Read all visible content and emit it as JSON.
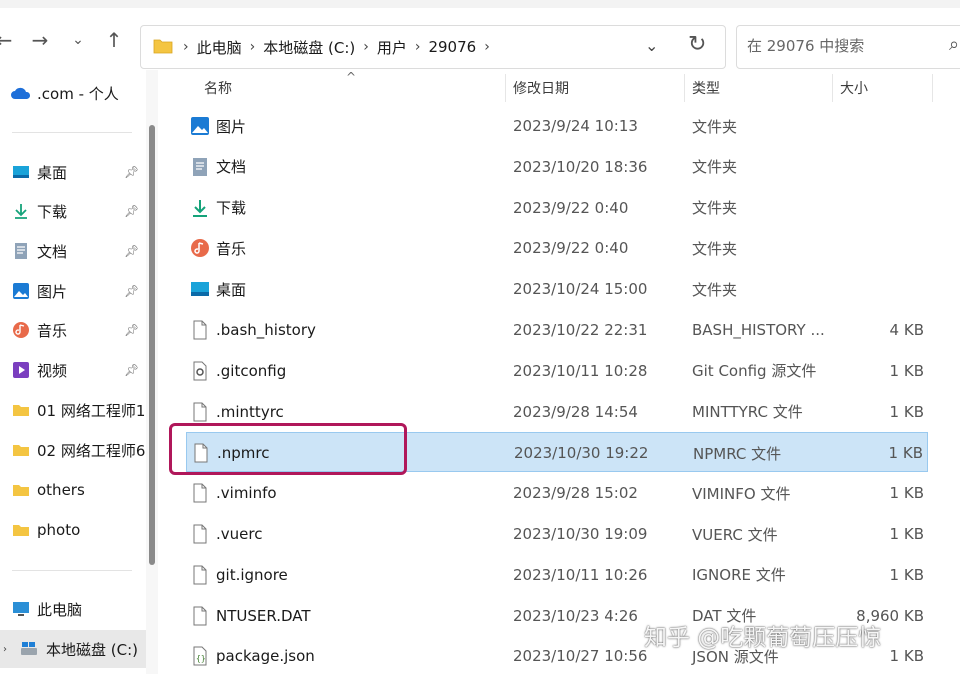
{
  "nav": {
    "breadcrumbs": [
      "此电脑",
      "本地磁盘 (C:)",
      "用户",
      "29076"
    ],
    "search_placeholder": "在 29076 中搜索"
  },
  "sidebar": {
    "onedrive": ".com - 个人",
    "quick": [
      {
        "label": "桌面",
        "icon": "desktop-icon"
      },
      {
        "label": "下载",
        "icon": "download-icon"
      },
      {
        "label": "文档",
        "icon": "document-icon"
      },
      {
        "label": "图片",
        "icon": "pictures-icon"
      },
      {
        "label": "音乐",
        "icon": "music-icon"
      },
      {
        "label": "视频",
        "icon": "video-icon"
      }
    ],
    "folders": [
      "01 网络工程师1",
      "02 网络工程师6",
      "others",
      "photo"
    ],
    "this_pc": "此电脑",
    "local_disk": "本地磁盘 (C:)"
  },
  "columns": {
    "name": "名称",
    "date": "修改日期",
    "type": "类型",
    "size": "大小"
  },
  "files": [
    {
      "name": "图片",
      "date": "2023/9/24 10:13",
      "type": "文件夹",
      "size": "",
      "icon": "pictures-icon"
    },
    {
      "name": "文档",
      "date": "2023/10/20 18:36",
      "type": "文件夹",
      "size": "",
      "icon": "document-icon"
    },
    {
      "name": "下载",
      "date": "2023/9/22 0:40",
      "type": "文件夹",
      "size": "",
      "icon": "download-icon"
    },
    {
      "name": "音乐",
      "date": "2023/9/22 0:40",
      "type": "文件夹",
      "size": "",
      "icon": "music-icon"
    },
    {
      "name": "桌面",
      "date": "2023/10/24 15:00",
      "type": "文件夹",
      "size": "",
      "icon": "desktop-icon"
    },
    {
      "name": ".bash_history",
      "date": "2023/10/22 22:31",
      "type": "BASH_HISTORY ...",
      "size": "4 KB",
      "icon": "file-icon"
    },
    {
      "name": ".gitconfig",
      "date": "2023/10/11 10:28",
      "type": "Git Config 源文件",
      "size": "1 KB",
      "icon": "config-file-icon"
    },
    {
      "name": ".minttyrc",
      "date": "2023/9/28 14:54",
      "type": "MINTTYRC 文件",
      "size": "1 KB",
      "icon": "file-icon"
    },
    {
      "name": ".npmrc",
      "date": "2023/10/30 19:22",
      "type": "NPMRC 文件",
      "size": "1 KB",
      "icon": "file-icon"
    },
    {
      "name": ".viminfo",
      "date": "2023/9/28 15:02",
      "type": "VIMINFO 文件",
      "size": "1 KB",
      "icon": "file-icon"
    },
    {
      "name": ".vuerc",
      "date": "2023/10/30 19:09",
      "type": "VUERC 文件",
      "size": "1 KB",
      "icon": "file-icon"
    },
    {
      "name": "git.ignore",
      "date": "2023/10/11 10:26",
      "type": "IGNORE 文件",
      "size": "1 KB",
      "icon": "file-icon"
    },
    {
      "name": "NTUSER.DAT",
      "date": "2023/10/23 4:26",
      "type": "DAT 文件",
      "size": "8,960 KB",
      "icon": "file-icon"
    },
    {
      "name": "package.json",
      "date": "2023/10/27 10:56",
      "type": "JSON 源文件",
      "size": "1 KB",
      "icon": "json-file-icon"
    }
  ],
  "selected_file": ".npmrc",
  "watermark": "知乎 @吃颗葡萄压压惊",
  "colors": {
    "selection": "#cce4f7",
    "highlight_border": "#b0175a",
    "folder": "#f4c542"
  }
}
